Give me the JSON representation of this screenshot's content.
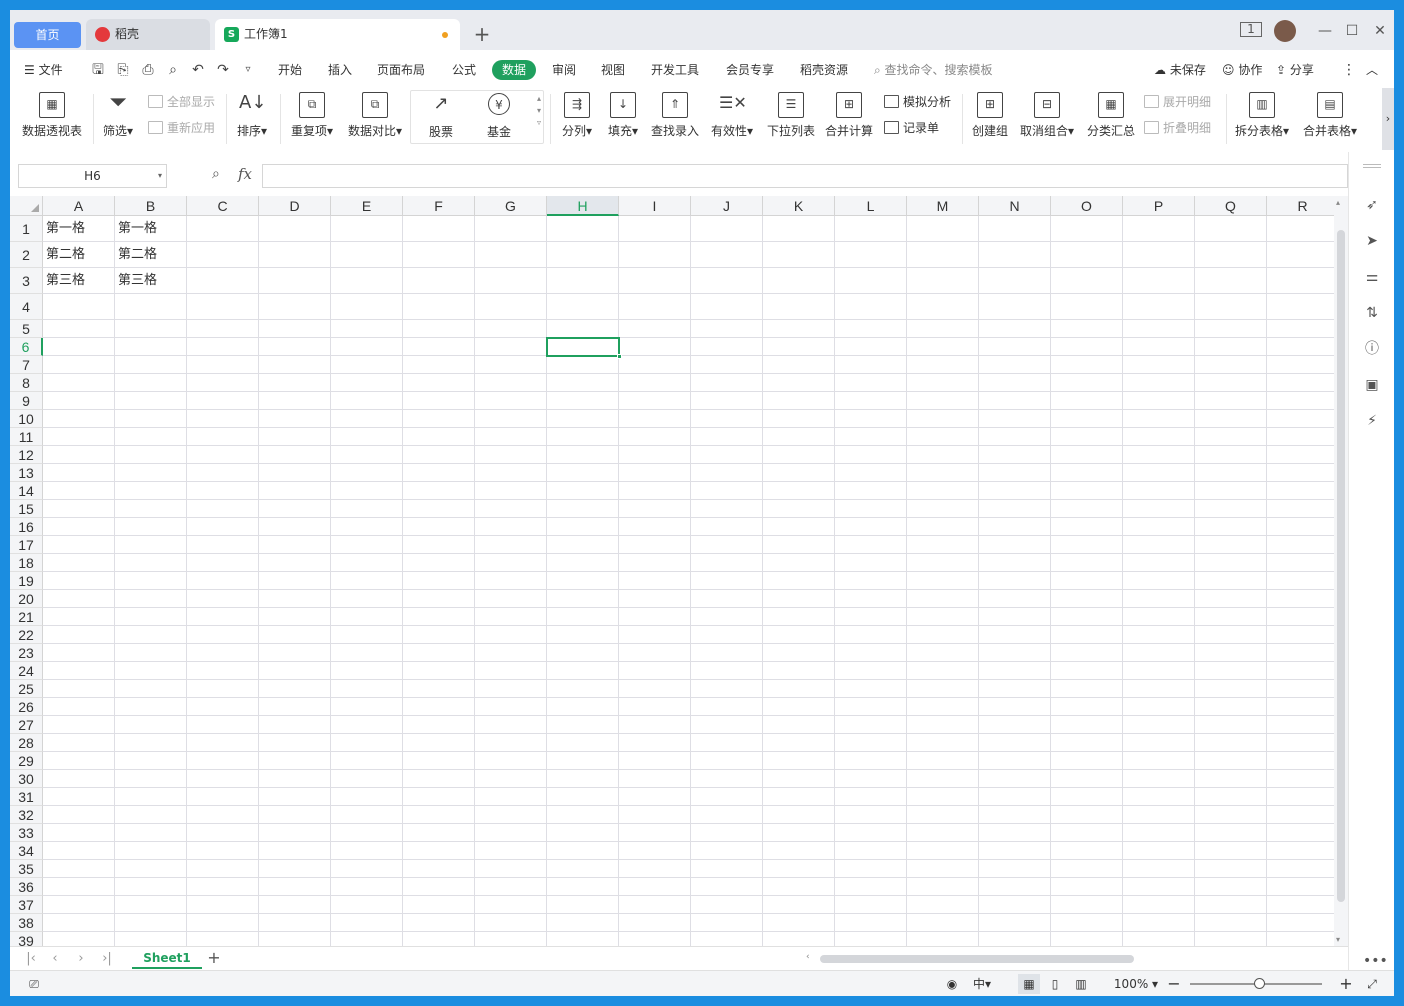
{
  "tabs": {
    "home": "首页",
    "docer": "稻壳",
    "workbook": "工作簿1"
  },
  "icons": {
    "new_tab": "+",
    "minimize": "—",
    "maximize": "☐",
    "close": "✕",
    "layout": "1⃞"
  },
  "menu": {
    "file": "文件",
    "items": [
      "开始",
      "插入",
      "页面布局",
      "公式",
      "数据",
      "审阅",
      "视图",
      "开发工具",
      "会员专享",
      "稻壳资源"
    ],
    "active": "数据",
    "search_placeholder": "查找命令、搜索模板",
    "unsaved": "未保存",
    "collab": "协作",
    "share": "分享"
  },
  "ribbon": {
    "pivot": "数据透视表",
    "filter": "筛选",
    "show_all": "全部显示",
    "reapply": "重新应用",
    "sort": "排序",
    "duplicates": "重复项",
    "compare": "数据对比",
    "stock": "股票",
    "fund": "基金",
    "split_col": "分列",
    "fill": "填充",
    "lookup": "查找录入",
    "validity": "有效性",
    "dropdown": "下拉列表",
    "consolidate": "合并计算",
    "whatif": "模拟分析",
    "record": "记录单",
    "group": "创建组",
    "ungroup": "取消组合",
    "subtotal": "分类汇总",
    "expand": "展开明细",
    "collapse": "折叠明细",
    "split_table": "拆分表格",
    "merge_table": "合并表格"
  },
  "formula_bar": {
    "name_box": "H6",
    "fx": "fx",
    "formula": ""
  },
  "grid": {
    "columns": [
      "A",
      "B",
      "C",
      "D",
      "E",
      "F",
      "G",
      "H",
      "I",
      "J",
      "K",
      "L",
      "M",
      "N",
      "O",
      "P",
      "Q",
      "R"
    ],
    "selected_column": "H",
    "selected_row": 6,
    "row_count": 39,
    "cells": {
      "A1": "第一格",
      "B1": "第一格",
      "A2": "第二格",
      "B2": "第二格",
      "A3": "第三格",
      "B3": "第三格"
    }
  },
  "sheets": {
    "active": "Sheet1"
  },
  "status": {
    "zoom": "100%"
  }
}
